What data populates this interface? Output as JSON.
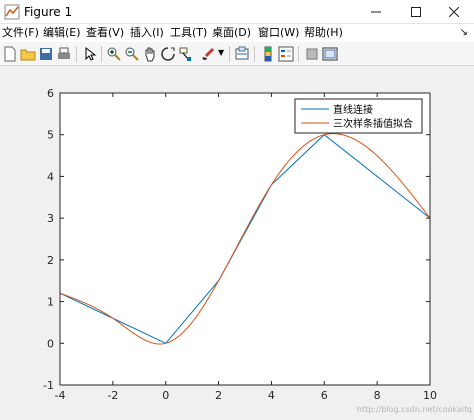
{
  "window": {
    "title": "Figure 1"
  },
  "menu": [
    "文件(F)",
    "编辑(E)",
    "查看(V)",
    "插入(I)",
    "工具(T)",
    "桌面(D)",
    "窗口(W)",
    "帮助(H)"
  ],
  "toolbar": {
    "buttons": [
      {
        "name": "new-figure-icon"
      },
      {
        "name": "open-file-icon"
      },
      {
        "name": "save-icon"
      },
      {
        "name": "print-icon"
      },
      {
        "name": "edit-plot-arrow-icon"
      },
      {
        "name": "zoom-in-icon"
      },
      {
        "name": "zoom-out-icon"
      },
      {
        "name": "pan-hand-icon"
      },
      {
        "name": "rotate-3d-icon"
      },
      {
        "name": "data-cursor-icon"
      },
      {
        "name": "brush-icon"
      },
      {
        "name": "link-plot-icon"
      },
      {
        "name": "insert-colorbar-icon"
      },
      {
        "name": "insert-legend-icon"
      },
      {
        "name": "hide-plot-tools-icon"
      },
      {
        "name": "show-plot-tools-icon"
      }
    ]
  },
  "watermark": "http://blog.csdn.net/cookaifq",
  "chart_data": {
    "type": "line",
    "title": "",
    "xlabel": "",
    "ylabel": "",
    "xlim": [
      -4,
      10
    ],
    "ylim": [
      -1,
      6
    ],
    "xticks": [
      -4,
      -2,
      0,
      2,
      4,
      6,
      8,
      10
    ],
    "yticks": [
      -1,
      0,
      1,
      2,
      3,
      4,
      5,
      6
    ],
    "grid": false,
    "legend_position": "top-right",
    "series": [
      {
        "name": "直线连接",
        "color": "#0072bd",
        "style": "polyline",
        "x": [
          -4,
          -2,
          0,
          2,
          4,
          6,
          10
        ],
        "y": [
          1.2,
          0.6,
          0,
          1.5,
          3.8,
          5.0,
          3.0
        ]
      },
      {
        "name": "三次样条插值拟合",
        "color": "#d95319",
        "style": "spline",
        "x": [
          -4,
          -2,
          0,
          2,
          4,
          6,
          10
        ],
        "y": [
          1.2,
          0.6,
          0,
          1.5,
          3.8,
          5.0,
          3.0
        ]
      }
    ]
  }
}
